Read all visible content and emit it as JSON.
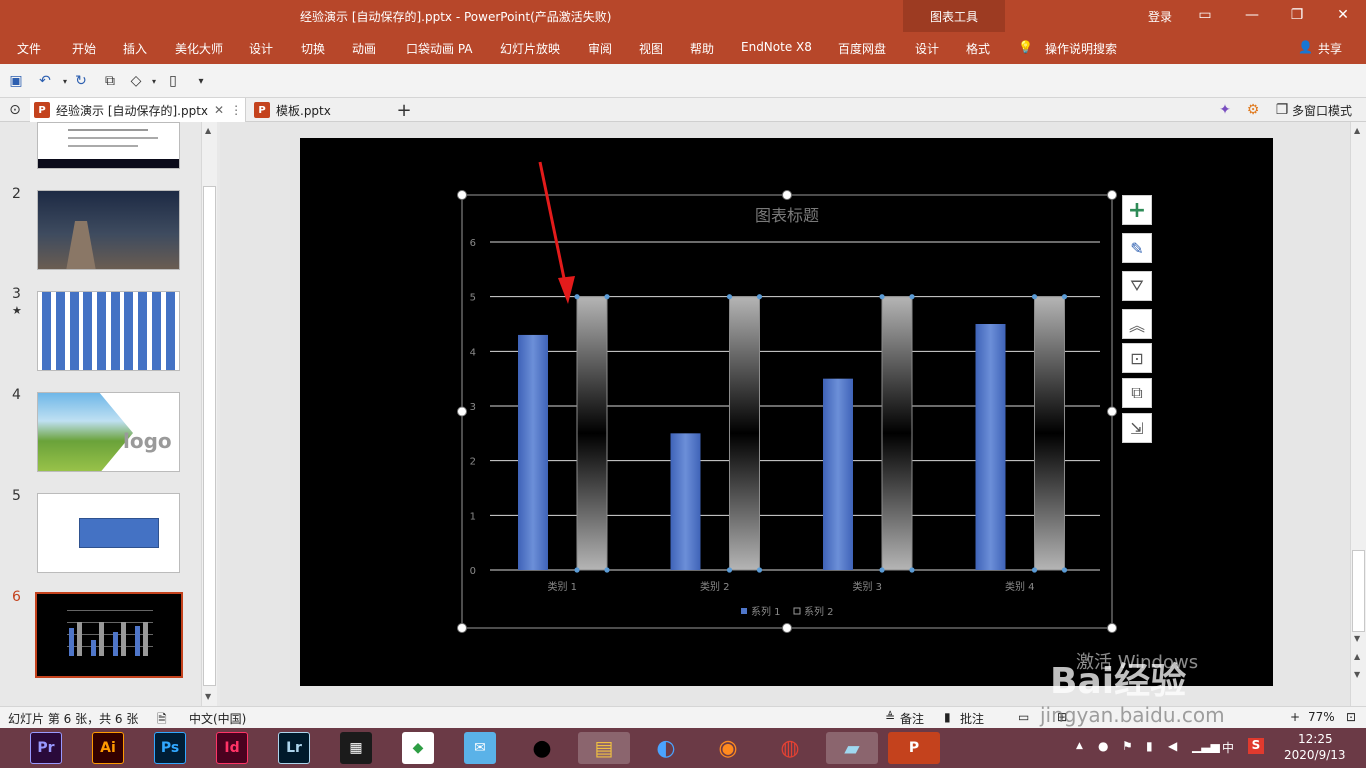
{
  "titlebar": {
    "title": "经验演示 [自动保存的].pptx  -  PowerPoint(产品激活失败)",
    "tool_group": "图表工具",
    "login": "登录"
  },
  "menu": [
    "文件",
    "开始",
    "插入",
    "美化大师",
    "设计",
    "切换",
    "动画",
    "口袋动画 PA",
    "幻灯片放映",
    "审阅",
    "视图",
    "帮助",
    "EndNote X8",
    "百度网盘",
    "设计",
    "格式"
  ],
  "search_label": "操作说明搜索",
  "share_label": "共享",
  "tabs": [
    {
      "label": "经验演示 [自动保存的].pptx",
      "active": true
    },
    {
      "label": "模板.pptx",
      "active": false
    }
  ],
  "multiwindow_label": "多窗口模式",
  "thumbnails": [
    {
      "num": "",
      "kind": "text"
    },
    {
      "num": "2",
      "kind": "photo"
    },
    {
      "num": "3",
      "star": "★",
      "kind": "bars"
    },
    {
      "num": "4",
      "kind": "logo",
      "logo_text": "logo"
    },
    {
      "num": "5",
      "kind": "rect"
    },
    {
      "num": "6",
      "kind": "chart",
      "active": true
    }
  ],
  "chart_data": {
    "type": "bar",
    "title": "图表标题",
    "categories": [
      "类别 1",
      "类别 2",
      "类别 3",
      "类别 4"
    ],
    "series": [
      {
        "name": "系列 1",
        "values": [
          4.3,
          2.5,
          3.5,
          4.5
        ],
        "color": "#4f76c9"
      },
      {
        "name": "系列 2",
        "values": [
          5,
          5,
          5,
          5
        ],
        "color": "#9a9a9a"
      }
    ],
    "ylim": [
      0,
      6
    ],
    "yticks": [
      "0",
      "1",
      "2",
      "3",
      "4",
      "5",
      "6"
    ],
    "grid": true,
    "legend": "bottom"
  },
  "watermark": {
    "activate": "激活 Windows",
    "baidu": "Bai经验",
    "url": "jingyan.baidu.com"
  },
  "status": {
    "slide_info": "幻灯片 第 6 张，共 6 张",
    "language": "中文(中国)",
    "notes": "备注",
    "comments": "批注",
    "zoom": "77%"
  },
  "taskbar": {
    "apps": [
      {
        "label": "Pr",
        "color": "#9999ff",
        "bg": "#2a0a3a"
      },
      {
        "label": "Ai",
        "color": "#ff9a00",
        "bg": "#330000"
      },
      {
        "label": "Ps",
        "color": "#31a8ff",
        "bg": "#001e36"
      },
      {
        "label": "Id",
        "color": "#ff3366",
        "bg": "#49021f"
      },
      {
        "label": "Lr",
        "color": "#add5ec",
        "bg": "#001a2b"
      }
    ],
    "time": "12:25",
    "date": "2020/9/13",
    "ime": "中"
  }
}
